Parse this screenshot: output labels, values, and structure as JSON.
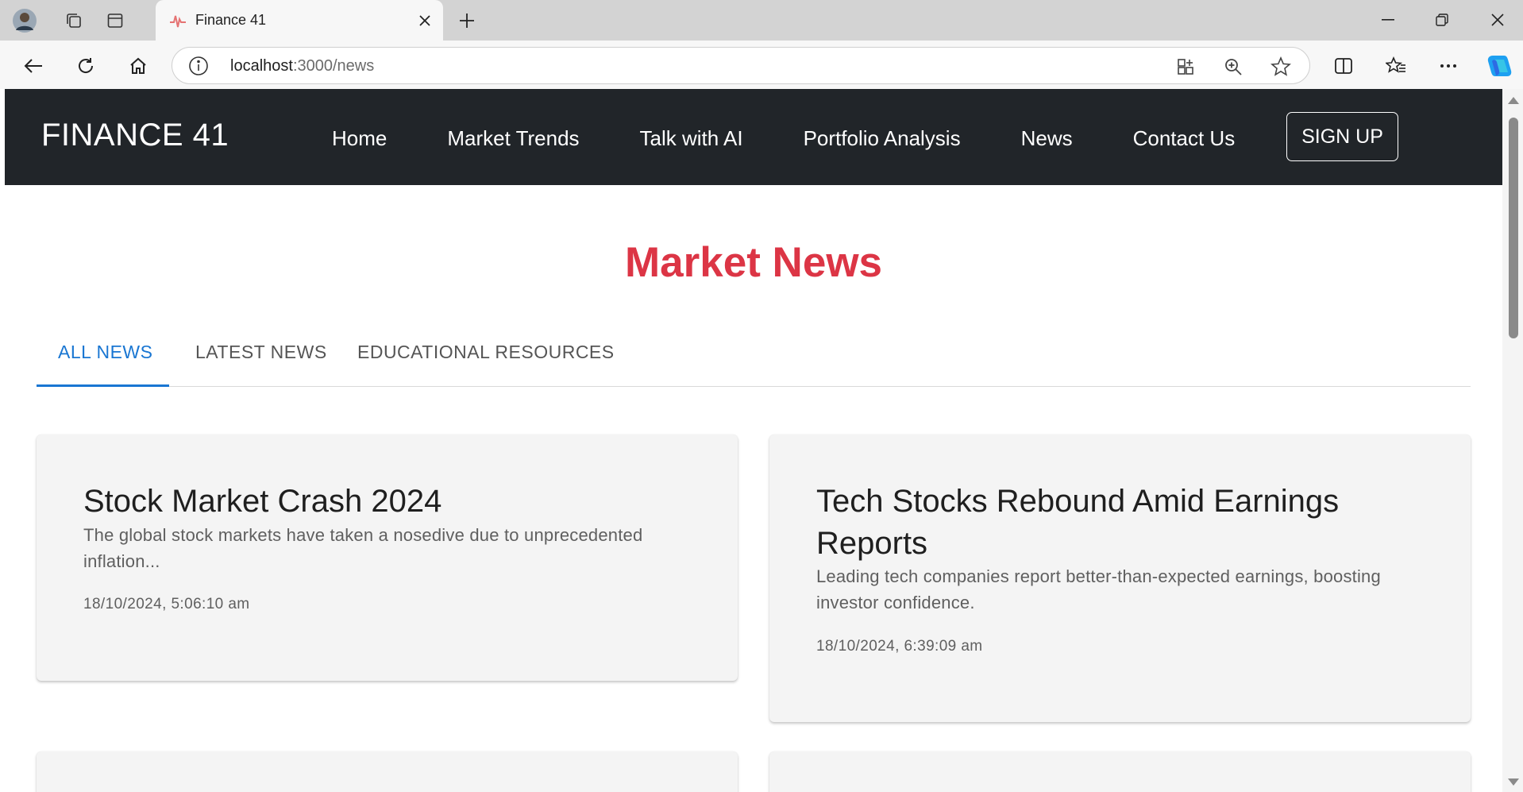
{
  "browser": {
    "tab_title": "Finance 41",
    "url_host": "localhost",
    "url_path": ":3000/news"
  },
  "site": {
    "brand": "FINANCE 41",
    "nav": [
      "Home",
      "Market Trends",
      "Talk with AI",
      "Portfolio Analysis",
      "News",
      "Contact Us"
    ],
    "signup_label": "SIGN UP",
    "accent_color": "#dc3545",
    "nav_bg": "#212529"
  },
  "page": {
    "heading": "Market News",
    "tabs": [
      "ALL NEWS",
      "LATEST NEWS",
      "EDUCATIONAL RESOURCES"
    ],
    "active_tab": "ALL NEWS",
    "tab_active_color": "#1976d2"
  },
  "articles": [
    {
      "title": "Stock Market Crash 2024",
      "description": "The global stock markets have taken a nosedive due to unprecedented inflation...",
      "date": "18/10/2024, 5:06:10 am"
    },
    {
      "title": "Tech Stocks Rebound Amid Earnings Reports",
      "description": "Leading tech companies report better-than-expected earnings, boosting investor confidence.",
      "date": "18/10/2024, 6:39:09 am"
    }
  ]
}
